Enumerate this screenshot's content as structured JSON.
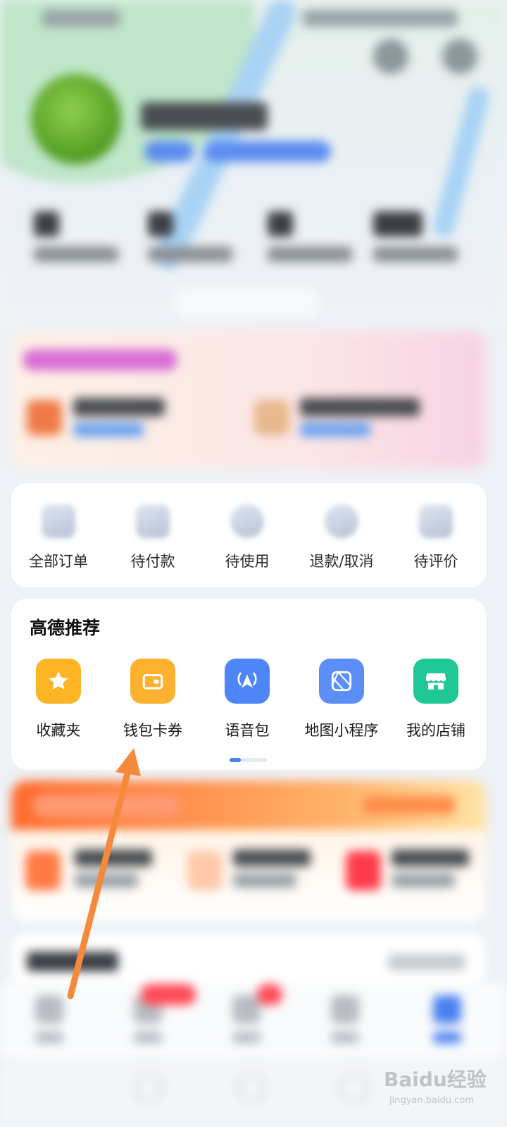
{
  "orders": {
    "items": [
      {
        "label": "全部订单",
        "icon": "all-orders-icon"
      },
      {
        "label": "待付款",
        "icon": "wallet-pay-icon"
      },
      {
        "label": "待使用",
        "icon": "clock-icon"
      },
      {
        "label": "退款/取消",
        "icon": "refund-icon"
      },
      {
        "label": "待评价",
        "icon": "comment-icon"
      }
    ]
  },
  "recommend": {
    "title": "高德推荐",
    "items": [
      {
        "label": "收藏夹",
        "icon": "star-icon",
        "color": "#FDB526"
      },
      {
        "label": "钱包卡券",
        "icon": "wallet-icon",
        "color": "#FDB12F"
      },
      {
        "label": "语音包",
        "icon": "navigation-voice-icon",
        "color": "#4F86F7"
      },
      {
        "label": "地图小程序",
        "icon": "mini-program-icon",
        "color": "#5B8EF6"
      },
      {
        "label": "我的店铺",
        "icon": "shop-icon",
        "color": "#1FC796"
      }
    ],
    "page_index": 1,
    "page_count": 3
  },
  "annotation": {
    "type": "arrow",
    "color": "#F58A3D",
    "target": "钱包卡券"
  },
  "watermark": {
    "text": "Baidu经验",
    "subtext": "jingyan.baidu.com"
  },
  "colors": {
    "accent": "#4A80F0",
    "card": "#FFFFFF",
    "page": "#EEF1F5"
  }
}
